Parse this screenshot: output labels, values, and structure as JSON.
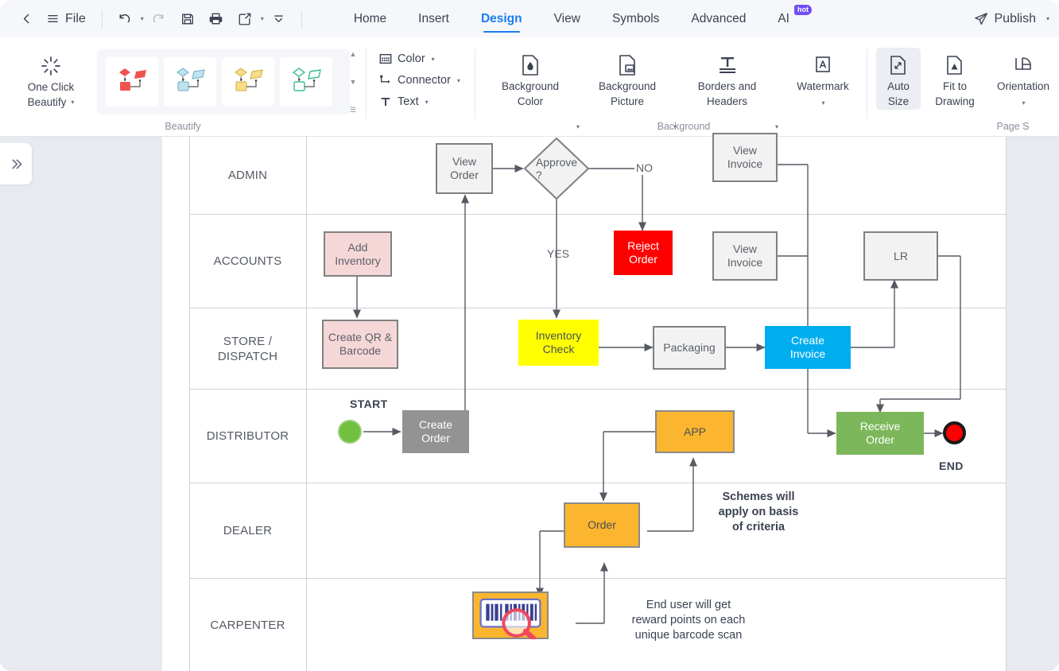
{
  "window": {
    "app_accent": "#1a7df0"
  },
  "menubar": {
    "back_icon": "chevron-left-icon",
    "file_icon": "hamburger-icon",
    "file_label": "File",
    "undo_icon": "undo-icon",
    "redo_icon": "redo-icon",
    "save_icon": "save-icon",
    "print_icon": "print-icon",
    "export_icon": "export-share-icon",
    "more_icon": "chevron-double-down-icon",
    "tabs": [
      {
        "label": "Home",
        "active": false
      },
      {
        "label": "Insert",
        "active": false
      },
      {
        "label": "Design",
        "active": true
      },
      {
        "label": "View",
        "active": false
      },
      {
        "label": "Symbols",
        "active": false
      },
      {
        "label": "Advanced",
        "active": false
      },
      {
        "label": "AI",
        "active": false,
        "badge": "hot"
      }
    ],
    "publish_icon": "paper-plane-icon",
    "publish_label": "Publish"
  },
  "ribbon": {
    "groups": [
      {
        "name": "Beautify",
        "label": "Beautify"
      },
      {
        "name": "Background",
        "label": "Background"
      },
      {
        "name": "PageSetup",
        "label": "Page S"
      }
    ],
    "one_click_beautify": {
      "icon": "sparkle-beautify-icon",
      "line1": "One Click",
      "line2": "Beautify"
    },
    "style_presets": [
      {
        "name": "style-preset-red",
        "color": "#ef5350"
      },
      {
        "name": "style-preset-blue",
        "color": "#a8d8e8"
      },
      {
        "name": "style-preset-yellow",
        "color": "#f5d67a"
      },
      {
        "name": "style-preset-green",
        "color": "#5cc9a0"
      }
    ],
    "small_buttons": [
      {
        "icon": "color-grid-icon",
        "label": "Color"
      },
      {
        "icon": "connector-icon",
        "label": "Connector"
      },
      {
        "icon": "text-t-icon",
        "label": "Text"
      }
    ],
    "background_buttons": [
      {
        "icon": "background-color-icon",
        "line1": "Background",
        "line2": "Color",
        "has_caret": true
      },
      {
        "icon": "background-picture-icon",
        "line1": "Background",
        "line2": "Picture",
        "has_caret": true
      },
      {
        "icon": "borders-headers-icon",
        "line1": "Borders and",
        "line2": "Headers",
        "has_caret": true
      },
      {
        "icon": "watermark-icon",
        "line1": "Watermark",
        "line2": "",
        "has_caret": true
      }
    ],
    "page_buttons": [
      {
        "icon": "auto-size-icon",
        "line1": "Auto",
        "line2": "Size",
        "selected": true
      },
      {
        "icon": "fit-to-drawing-icon",
        "line1": "Fit to",
        "line2": "Drawing",
        "selected": false
      },
      {
        "icon": "orientation-icon",
        "line1": "Orientation",
        "line2": "",
        "selected": false,
        "has_caret": true
      }
    ]
  },
  "workspace": {
    "expand_panel_icon": "chevron-double-right-icon"
  },
  "diagram": {
    "lanes": [
      {
        "title": "ADMIN"
      },
      {
        "title": "ACCOUNTS"
      },
      {
        "title": "STORE /\nDISPATCH"
      },
      {
        "title": "DISTRIBUTOR"
      },
      {
        "title": "DEALER"
      },
      {
        "title": "CARPENTER"
      }
    ],
    "nodes": [
      {
        "id": "view-order",
        "text": "View\nOrder",
        "style": "gray-outline"
      },
      {
        "id": "approve",
        "text": "Approve\n?",
        "style": "diamond"
      },
      {
        "id": "view-invoice-1",
        "text": "View\nInvoice",
        "style": "gray-outline"
      },
      {
        "id": "add-inventory",
        "text": "Add\nInventory",
        "style": "pink"
      },
      {
        "id": "reject-order",
        "text": "Reject\nOrder",
        "style": "red"
      },
      {
        "id": "view-invoice-2",
        "text": "View\nInvoice",
        "style": "gray-outline"
      },
      {
        "id": "lr",
        "text": "LR",
        "style": "gray-outline"
      },
      {
        "id": "create-qr",
        "text": "Create QR &\nBarcode",
        "style": "pink"
      },
      {
        "id": "inventory-check",
        "text": "Inventory\nCheck",
        "style": "yellow"
      },
      {
        "id": "packaging",
        "text": "Packaging",
        "style": "gray-outline"
      },
      {
        "id": "create-invoice",
        "text": "Create\nInvoice",
        "style": "blue"
      },
      {
        "id": "create-order",
        "text": "Create\nOrder",
        "style": "gray-fill"
      },
      {
        "id": "app",
        "text": "APP",
        "style": "orange"
      },
      {
        "id": "receive-order",
        "text": "Receive\nOrder",
        "style": "green"
      },
      {
        "id": "order",
        "text": "Order",
        "style": "orange"
      },
      {
        "id": "barcode-scan",
        "text": "",
        "style": "barcode"
      }
    ],
    "labels": {
      "no": "NO",
      "yes": "YES",
      "start": "START",
      "end": "END"
    },
    "notes": [
      {
        "id": "schemes-note",
        "text": "Schemes will\napply on basis\nof criteria",
        "bold": true
      },
      {
        "id": "reward-note",
        "text": "End user will get\nreward points on each\nunique barcode scan",
        "bold": false
      }
    ]
  }
}
